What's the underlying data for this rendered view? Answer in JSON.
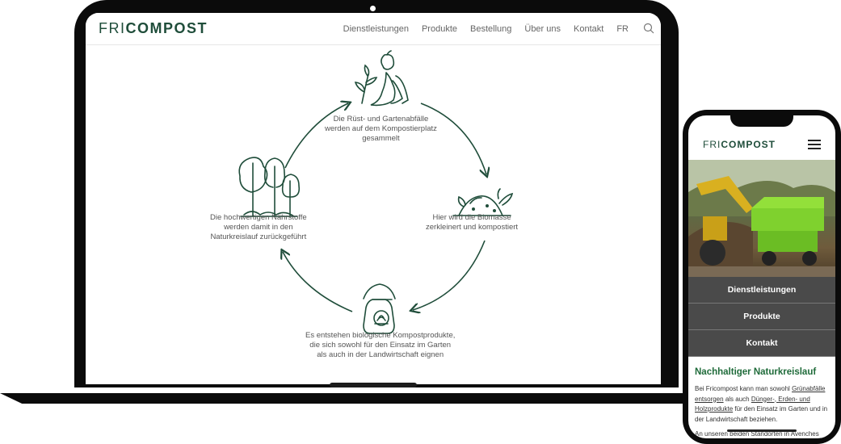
{
  "brand": {
    "part1": "FRI",
    "part2": "COMPOST"
  },
  "nav": [
    "Dienstleistungen",
    "Produkte",
    "Bestellung",
    "Über uns",
    "Kontakt",
    "FR"
  ],
  "cycle": {
    "steps": [
      {
        "lines": [
          "Die Rüst- und Gartenabfälle",
          "werden auf dem Kompostierplatz",
          "gesammelt"
        ]
      },
      {
        "lines": [
          "Hier wird die Biomasse",
          "zerkleinert und kompostiert"
        ]
      },
      {
        "lines": [
          "Es entstehen biologische Kompostprodukte,",
          "die sich sowohl für den Einsatz im Garten",
          "als auch in der Landwirtschaft eignen"
        ]
      },
      {
        "lines": [
          "Die hochwertigen Nährstoffe",
          "werden damit in den",
          "Naturkreislauf zurückgeführt"
        ]
      }
    ]
  },
  "mobile": {
    "menu": [
      "Dienstleistungen",
      "Produkte",
      "Kontakt"
    ],
    "heading": "Nachhaltiger Naturkreislauf",
    "paragraph": {
      "t1": "Bei Fricompost kann man sowohl ",
      "link1": "Grünabfälle entsorgen",
      "t2": " als auch ",
      "link2": "Dünger-, Erden- und Holzprodukte",
      "t3": " für den Einsatz im Garten und in der Landwirtschaft beziehen."
    },
    "paragraph2": "An unseren beiden Standorten in Avenches"
  },
  "colors": {
    "brand_green": "#1f4d3a",
    "heading_green": "#1f6b3a",
    "menu_gray": "#4a4a4a"
  }
}
